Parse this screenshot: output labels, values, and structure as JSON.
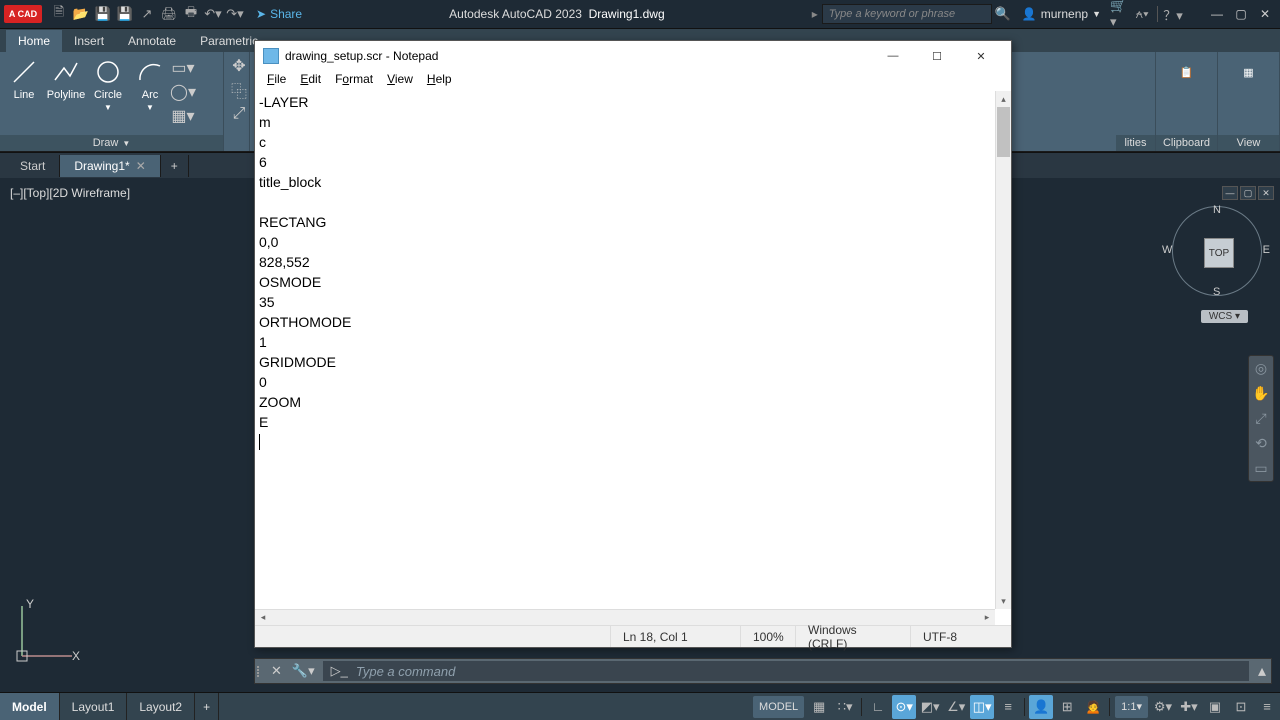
{
  "acad": {
    "logo": "A CAD",
    "share": "Share",
    "title_app": "Autodesk AutoCAD 2023",
    "title_file": "Drawing1.dwg",
    "search_placeholder": "Type a keyword or phrase",
    "user": "murnenp",
    "ribbon_tabs": [
      "Home",
      "Insert",
      "Annotate",
      "Parametric"
    ],
    "tools": {
      "line": "Line",
      "polyline": "Polyline",
      "circle": "Circle",
      "arc": "Arc",
      "draw_label": "Draw",
      "utilities": "lities",
      "clipboard": "Clipboard",
      "view": "View"
    },
    "file_tabs": {
      "start": "Start",
      "drawing": "Drawing1*",
      "plus": "+"
    },
    "viewport_label": "[–][Top][2D Wireframe]",
    "viewcube": {
      "face": "TOP",
      "n": "N",
      "s": "S",
      "e": "E",
      "w": "W"
    },
    "wcs": "WCS",
    "cmd_placeholder": "Type a command",
    "layouts": [
      "Model",
      "Layout1",
      "Layout2"
    ],
    "status": {
      "model": "MODEL",
      "scale": "1:1"
    }
  },
  "notepad": {
    "title": "drawing_setup.scr - Notepad",
    "menu": {
      "file": "File",
      "edit": "Edit",
      "format": "Format",
      "view": "View",
      "help": "Help"
    },
    "content": "-LAYER\nm\nc\n6\ntitle_block\n\nRECTANG\n0,0\n828,552\nOSMODE\n35\nORTHOMODE\n1\nGRIDMODE\n0\nZOOM\nE\n",
    "status": {
      "pos": "Ln 18, Col 1",
      "zoom": "100%",
      "eol": "Windows (CRLF)",
      "enc": "UTF-8"
    }
  }
}
